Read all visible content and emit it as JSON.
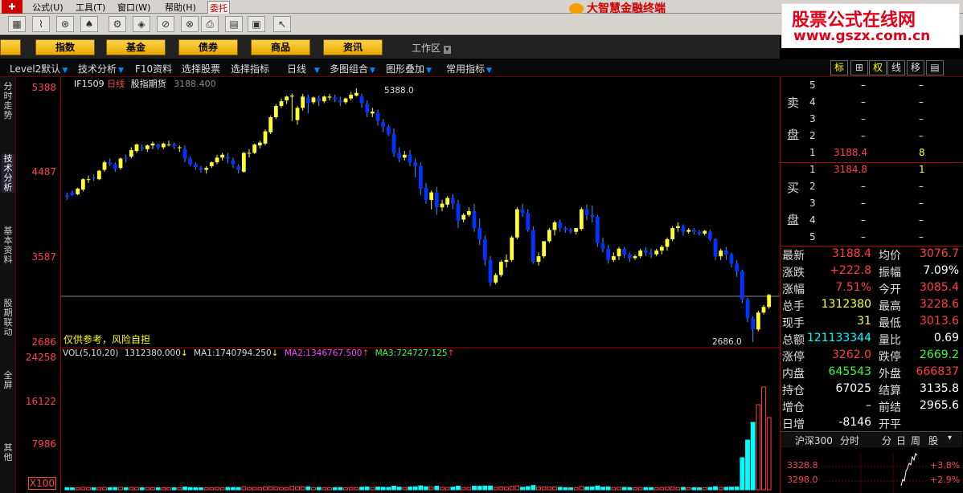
{
  "menu": {
    "items": [
      "公式(U)",
      "工具(T)",
      "窗口(W)",
      "帮助(H)",
      "委托"
    ],
    "brand": "大智慧金融终端"
  },
  "watermark": {
    "line1": "股票公式在线网",
    "line2": "www.gszx.com.cn"
  },
  "yellow_buttons": [
    "指数",
    "基金",
    "债券",
    "商品",
    "资讯"
  ],
  "workspace_label": "工作区",
  "tabs": [
    "Level2默认",
    "技术分析",
    "F10资料",
    "选择股票",
    "选择指标",
    "日线",
    "多图组合",
    "图形叠加",
    "常用指标"
  ],
  "right_tabs": [
    "标",
    "权",
    "线",
    "移"
  ],
  "left_tabs": [
    "分时走势",
    "技术分析",
    "基本资料",
    "股期联动",
    "全屏",
    "其他"
  ],
  "chart": {
    "symbol": "IF1509",
    "period": "日线",
    "name": "股指期货",
    "price": "3188.400",
    "y_labels": [
      "5388",
      "4487",
      "3587",
      "2686"
    ],
    "vol_labels": [
      "24258",
      "16122",
      "7986",
      "X100"
    ],
    "high_mark": "5388.0",
    "low_mark": "2686.0",
    "disclaimer": "仅供参考，风险自担",
    "vol_title": "VOL(5,10,20)",
    "vol_value": "1312380.000",
    "ma1_label": "MA1:",
    "ma1": "1740794.250",
    "ma2_label": "MA2:",
    "ma2": "1346767.500",
    "ma3_label": "MA3:",
    "ma3": "724727.125",
    "colors": {
      "up": "#ffff33",
      "down": "#0033ff",
      "ma_line": "#a0a0a0",
      "vol_up": "#00ffff",
      "vol_down": "#ff4040"
    }
  },
  "chart_data": {
    "type": "candlestick",
    "ylim": [
      2686,
      5388
    ],
    "candles": [
      [
        4250,
        4280,
        4230,
        4200
      ],
      [
        4280,
        4300,
        4250,
        4240
      ],
      [
        4260,
        4330,
        4320,
        4250
      ],
      [
        4310,
        4430,
        4420,
        4290
      ],
      [
        4420,
        4460,
        4420,
        4380
      ],
      [
        4440,
        4470,
        4430,
        4400
      ],
      [
        4420,
        4520,
        4510,
        4410
      ],
      [
        4520,
        4620,
        4600,
        4500
      ],
      [
        4600,
        4640,
        4580,
        4560
      ],
      [
        4580,
        4600,
        4530,
        4500
      ],
      [
        4540,
        4650,
        4640,
        4520
      ],
      [
        4650,
        4680,
        4640,
        4600
      ],
      [
        4660,
        4760,
        4730,
        4640
      ],
      [
        4720,
        4800,
        4790,
        4700
      ],
      [
        4760,
        4790,
        4750,
        4720
      ],
      [
        4740,
        4790,
        4780,
        4710
      ],
      [
        4780,
        4820,
        4800,
        4740
      ],
      [
        4790,
        4800,
        4760,
        4740
      ],
      [
        4760,
        4810,
        4800,
        4740
      ],
      [
        4790,
        4830,
        4790,
        4770
      ],
      [
        4790,
        4810,
        4770,
        4740
      ],
      [
        4760,
        4780,
        4760,
        4710
      ],
      [
        4740,
        4780,
        4640,
        4600
      ],
      [
        4640,
        4660,
        4580,
        4560
      ],
      [
        4580,
        4600,
        4550,
        4520
      ],
      [
        4540,
        4560,
        4520,
        4490
      ],
      [
        4520,
        4560,
        4540,
        4480
      ],
      [
        4560,
        4610,
        4600,
        4540
      ],
      [
        4600,
        4680,
        4650,
        4580
      ],
      [
        4650,
        4700,
        4680,
        4620
      ],
      [
        4660,
        4700,
        4640,
        4590
      ],
      [
        4620,
        4650,
        4580,
        4540
      ],
      [
        4560,
        4580,
        4520,
        4480
      ],
      [
        4500,
        4710,
        4700,
        4490
      ],
      [
        4700,
        4740,
        4700,
        4650
      ],
      [
        4700,
        4800,
        4790,
        4690
      ],
      [
        4780,
        4830,
        4810,
        4750
      ],
      [
        4800,
        4950,
        4930,
        4780
      ],
      [
        4920,
        5100,
        5080,
        4900
      ],
      [
        5080,
        5220,
        5200,
        5060
      ],
      [
        5200,
        5280,
        5250,
        5180
      ],
      [
        5260,
        5310,
        5300,
        5220
      ],
      [
        5300,
        5330,
        5310,
        5040
      ],
      [
        5050,
        5200,
        5180,
        5000
      ],
      [
        5180,
        5330,
        5300,
        5150
      ],
      [
        5290,
        5320,
        5230,
        5120
      ],
      [
        5240,
        5300,
        5290,
        5220
      ],
      [
        5280,
        5310,
        5250,
        5200
      ],
      [
        5250,
        5310,
        5300,
        5230
      ],
      [
        5290,
        5330,
        5300,
        5260
      ],
      [
        5290,
        5320,
        5270,
        5240
      ],
      [
        5260,
        5300,
        5240,
        5200
      ],
      [
        5240,
        5290,
        5280,
        5220
      ],
      [
        5280,
        5350,
        5320,
        5260
      ],
      [
        5310,
        5388,
        5340,
        5300
      ],
      [
        5300,
        5330,
        5230,
        5180
      ],
      [
        5220,
        5260,
        5130,
        5080
      ],
      [
        5120,
        5180,
        5140,
        5080
      ],
      [
        5130,
        5160,
        5040,
        4990
      ],
      [
        5030,
        5060,
        4980,
        4920
      ],
      [
        4980,
        5000,
        4900,
        4880
      ],
      [
        4900,
        4960,
        4700,
        4660
      ],
      [
        4700,
        4760,
        4640,
        4600
      ],
      [
        4650,
        4720,
        4680,
        4620
      ],
      [
        4680,
        4730,
        4600,
        4560
      ],
      [
        4600,
        4640,
        4560,
        4440
      ],
      [
        4560,
        4600,
        4320,
        4250
      ],
      [
        4330,
        4380,
        4200,
        4160
      ],
      [
        4200,
        4300,
        4280,
        4100
      ],
      [
        4280,
        4340,
        4120,
        4040
      ],
      [
        4120,
        4200,
        4160,
        4080
      ],
      [
        4150,
        4240,
        4220,
        4120
      ],
      [
        4220,
        4260,
        4160,
        4100
      ],
      [
        4160,
        4200,
        3980,
        3900
      ],
      [
        3990,
        4060,
        4040,
        3960
      ],
      [
        4040,
        4120,
        4080,
        4020
      ],
      [
        4080,
        4160,
        3900,
        3860
      ],
      [
        3900,
        4000,
        3780,
        3720
      ],
      [
        3780,
        3820,
        3560,
        3500
      ],
      [
        3560,
        3600,
        3320,
        3280
      ],
      [
        3320,
        3420,
        3400,
        3300
      ],
      [
        3400,
        3560,
        3540,
        3380
      ],
      [
        3540,
        3620,
        3560,
        3480
      ],
      [
        3560,
        3820,
        3800,
        3540
      ],
      [
        3800,
        4120,
        4100,
        3780
      ],
      [
        4100,
        4160,
        4060,
        4020
      ],
      [
        4060,
        4100,
        3880,
        3860
      ],
      [
        3880,
        3920,
        3540,
        3520
      ],
      [
        3540,
        3640,
        3600,
        3500
      ],
      [
        3600,
        3760,
        3760,
        3580
      ],
      [
        3760,
        3900,
        3880,
        3740
      ],
      [
        3880,
        3980,
        3960,
        3820
      ],
      [
        3960,
        3990,
        3900,
        3860
      ],
      [
        3900,
        3920,
        3880,
        3850
      ],
      [
        3880,
        3900,
        3860,
        3840
      ],
      [
        3860,
        3900,
        3900,
        3830
      ],
      [
        3890,
        4120,
        4100,
        3870
      ],
      [
        4100,
        4150,
        4040,
        3980
      ],
      [
        4040,
        4140,
        4020,
        3960
      ],
      [
        4020,
        4040,
        3740,
        3700
      ],
      [
        3740,
        3800,
        3680,
        3640
      ],
      [
        3680,
        3720,
        3560,
        3520
      ],
      [
        3560,
        3640,
        3600,
        3540
      ],
      [
        3600,
        3700,
        3680,
        3560
      ],
      [
        3680,
        3700,
        3620,
        3580
      ],
      [
        3620,
        3640,
        3580,
        3540
      ],
      [
        3580,
        3620,
        3600,
        3560
      ],
      [
        3600,
        3680,
        3660,
        3580
      ],
      [
        3660,
        3700,
        3640,
        3600
      ],
      [
        3640,
        3680,
        3620,
        3580
      ],
      [
        3620,
        3680,
        3660,
        3600
      ],
      [
        3660,
        3720,
        3700,
        3620
      ],
      [
        3700,
        3800,
        3780,
        3660
      ],
      [
        3780,
        3920,
        3900,
        3760
      ],
      [
        3900,
        3960,
        3920,
        3860
      ],
      [
        3920,
        3940,
        3860,
        3820
      ],
      [
        3860,
        3900,
        3880,
        3840
      ],
      [
        3880,
        3900,
        3860,
        3830
      ],
      [
        3860,
        3880,
        3840,
        3820
      ],
      [
        3840,
        3880,
        3870,
        3820
      ],
      [
        3860,
        3880,
        3780,
        3760
      ],
      [
        3780,
        3790,
        3600,
        3560
      ],
      [
        3600,
        3680,
        3660,
        3560
      ],
      [
        3660,
        3700,
        3620,
        3560
      ],
      [
        3620,
        3640,
        3520,
        3480
      ],
      [
        3520,
        3560,
        3440,
        3380
      ],
      [
        3440,
        3460,
        3140,
        3100
      ],
      [
        3140,
        3160,
        2940,
        2900
      ],
      [
        2940,
        2960,
        2820,
        2686
      ],
      [
        2820,
        3020,
        3000,
        2800
      ],
      [
        3000,
        3080,
        3060,
        2980
      ],
      [
        3060,
        3200,
        3188,
        3040
      ]
    ],
    "volume_ylim": [
      0,
      24258
    ],
    "volume_scale": "X100"
  },
  "orderbook": {
    "sell_label": [
      "卖",
      "盘"
    ],
    "buy_label": [
      "买",
      "盘"
    ],
    "sell": [
      {
        "lvl": "5",
        "price": "–",
        "vol": "–"
      },
      {
        "lvl": "4",
        "price": "–",
        "vol": "–"
      },
      {
        "lvl": "3",
        "price": "–",
        "vol": "–"
      },
      {
        "lvl": "2",
        "price": "–",
        "vol": "–"
      },
      {
        "lvl": "1",
        "price": "3188.4",
        "vol": "8"
      }
    ],
    "buy": [
      {
        "lvl": "1",
        "price": "3184.8",
        "vol": "1"
      },
      {
        "lvl": "2",
        "price": "–",
        "vol": "–"
      },
      {
        "lvl": "3",
        "price": "–",
        "vol": "–"
      },
      {
        "lvl": "4",
        "price": "–",
        "vol": "–"
      },
      {
        "lvl": "5",
        "price": "–",
        "vol": "–"
      }
    ]
  },
  "quotes": [
    {
      "l1": "最新",
      "v1": "3188.4",
      "c1": "#ff4040",
      "l2": "均价",
      "v2": "3076.7",
      "c2": "#ff4040"
    },
    {
      "l1": "涨跌",
      "v1": "+222.8",
      "c1": "#ff4040",
      "l2": "振幅",
      "v2": "7.09%",
      "c2": "#ffffff"
    },
    {
      "l1": "涨幅",
      "v1": "7.51%",
      "c1": "#ff4040",
      "l2": "今开",
      "v2": "3085.4",
      "c2": "#ff4040"
    },
    {
      "l1": "总手",
      "v1": "1312380",
      "c1": "#ffff33",
      "l2": "最高",
      "v2": "3228.6",
      "c2": "#ff4040"
    },
    {
      "l1": "现手",
      "v1": "31",
      "c1": "#ffff33",
      "l2": "最低",
      "v2": "3013.6",
      "c2": "#ff4040"
    },
    {
      "l1": "总额",
      "v1": "121133344",
      "c1": "#00ffff",
      "l2": "量比",
      "v2": "0.69",
      "c2": "#ffffff"
    },
    {
      "l1": "涨停",
      "v1": "3262.0",
      "c1": "#ff4040",
      "l2": "跌停",
      "v2": "2669.2",
      "c2": "#33ff33"
    },
    {
      "l1": "内盘",
      "v1": "645543",
      "c1": "#33ff33",
      "l2": "外盘",
      "v2": "666837",
      "c2": "#ff4040"
    },
    {
      "l1": "持仓",
      "v1": "67025",
      "c1": "#ffffff",
      "l2": "结算",
      "v2": "3135.8",
      "c2": "#ffffff"
    },
    {
      "l1": "增仓",
      "v1": "–",
      "c1": "#ffffff",
      "l2": "前结",
      "v2": "2965.6",
      "c2": "#ffffff"
    },
    {
      "l1": "日增",
      "v1": "-8146",
      "c1": "#ffffff",
      "l2": "开平",
      "v2": "",
      "c2": "#ffffff"
    }
  ],
  "index_bar": {
    "name": "沪深300",
    "mode": "分时",
    "tabs": [
      "分",
      "日",
      "周",
      "股"
    ]
  },
  "mini_chart": {
    "labels": [
      "3328.8",
      "3298.0"
    ],
    "pcts": [
      "+3.8%",
      "+2.9%"
    ]
  }
}
